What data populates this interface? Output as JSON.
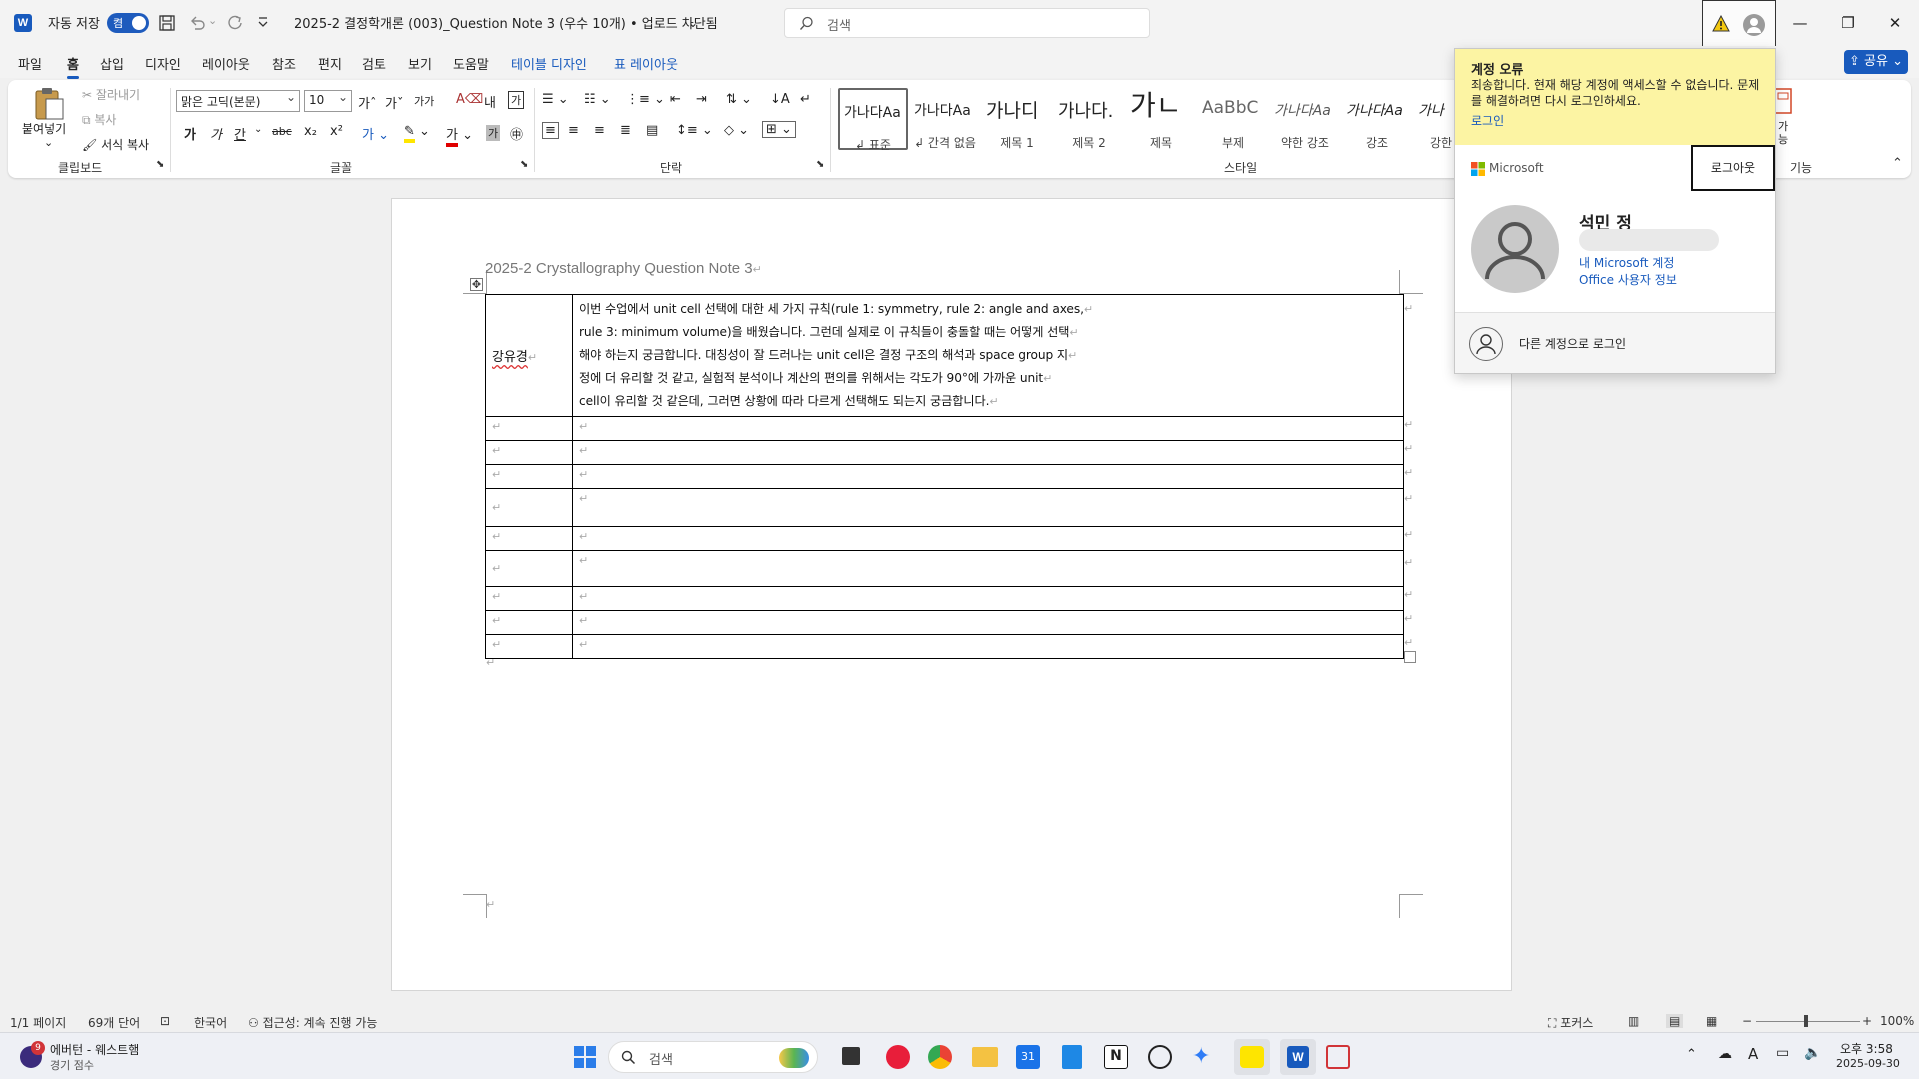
{
  "titlebar": {
    "app_icon": "W",
    "autosave_label": "자동 저장",
    "autosave_state": "켬",
    "doc_title": "2025-2 결정학개론 (003)_Question Note 3 (우수 10개) • 업로드 차단됨",
    "search_placeholder": "검색",
    "minimize_icon": "minimize-icon",
    "maximize_icon": "restore-icon",
    "close_icon": "close-icon"
  },
  "menu": {
    "tabs": [
      "파일",
      "홈",
      "삽입",
      "디자인",
      "레이아웃",
      "참조",
      "편지",
      "검토",
      "보기",
      "도움말",
      "테이블 디자인",
      "표 레이아웃"
    ],
    "active": "홈",
    "share_label": "공유"
  },
  "ribbon": {
    "clipboard": {
      "paste": "붙여넣기",
      "cut": "잘라내기",
      "copy": "복사",
      "format_painter": "서식 복사",
      "group_label": "클립보드"
    },
    "font": {
      "font_name": "맑은 고딕(본문)",
      "font_size": "10",
      "group_label": "글꼴",
      "grow": "가ˆ",
      "shrink": "가ˇ",
      "case": "가가",
      "bold": "가",
      "italic": "가",
      "underline": "간",
      "strike": "abc",
      "sub": "x₂",
      "sup": "x²"
    },
    "paragraph": {
      "group_label": "단락"
    },
    "styles": {
      "group_label": "스타일",
      "items": [
        {
          "sample": "가나다Aa",
          "name": "↲ 표준"
        },
        {
          "sample": "가나다Aa",
          "name": "↲ 간격 없음"
        },
        {
          "sample": "가나디",
          "name": "제목 1"
        },
        {
          "sample": "가나다.",
          "name": "제목 2"
        },
        {
          "sample": "가ㄴ",
          "name": "제목"
        },
        {
          "sample": "AaBbC",
          "name": "부제"
        },
        {
          "sample": "가나다Aa",
          "name": "약한 강조"
        },
        {
          "sample": "가나다Aa",
          "name": "강조"
        },
        {
          "sample": "가나",
          "name": "강한"
        }
      ]
    },
    "features_label": "기능",
    "features_short": "가능"
  },
  "document": {
    "header": "2025-2 Crystallography Question Note 3",
    "rows": [
      {
        "name": "강유경",
        "lines": [
          "이번 수업에서 unit cell 선택에 대한 세 가지 규칙(rule 1: symmetry, rule 2: angle and axes,",
          "rule 3: minimum volume)을 배웠습니다. 그런데 실제로 이 규칙들이 충돌할 때는 어떻게 선택",
          "해야 하는지 궁금합니다. 대칭성이 잘 드러나는 unit cell은 결정 구조의 해석과 space group 지",
          "정에 더 유리할 것 같고, 실험적 분석이나 계산의 편의를 위해서는 각도가 90°에 가까운 unit",
          "cell이 유리할 것 같은데, 그러면 상황에 따라 다르게 선택해도 되는지 궁금합니다."
        ]
      }
    ],
    "para_mark": "↵"
  },
  "account_popup": {
    "error_title": "계정 오류",
    "error_message": "죄송합니다. 현재 해당 계정에 액세스할 수 없습니다. 문제를 해결하려면 다시 로그인하세요.",
    "login_link": "로그인",
    "brand": "Microsoft",
    "logout": "로그아웃",
    "user_name": "석민 정",
    "my_account": "내 Microsoft 계정",
    "office_info": "Office 사용자 정보",
    "other_login": "다른 계정으로 로그인"
  },
  "statusbar": {
    "page": "1/1 페이지",
    "words": "69개 단어",
    "language": "한국어",
    "accessibility": "접근성: 계속 진행 가능",
    "focus": "포커스",
    "zoom": "100%"
  },
  "taskbar": {
    "widget_badge": "9",
    "widget_title": "에버턴 - 웨스트햄",
    "widget_sub": "경기 점수",
    "search_placeholder": "검색",
    "time": "오후 3:58",
    "date": "2025-09-30",
    "calendar_day": "31"
  },
  "colors": {
    "accent": "#185abd",
    "error_band": "#fcf4a3"
  }
}
